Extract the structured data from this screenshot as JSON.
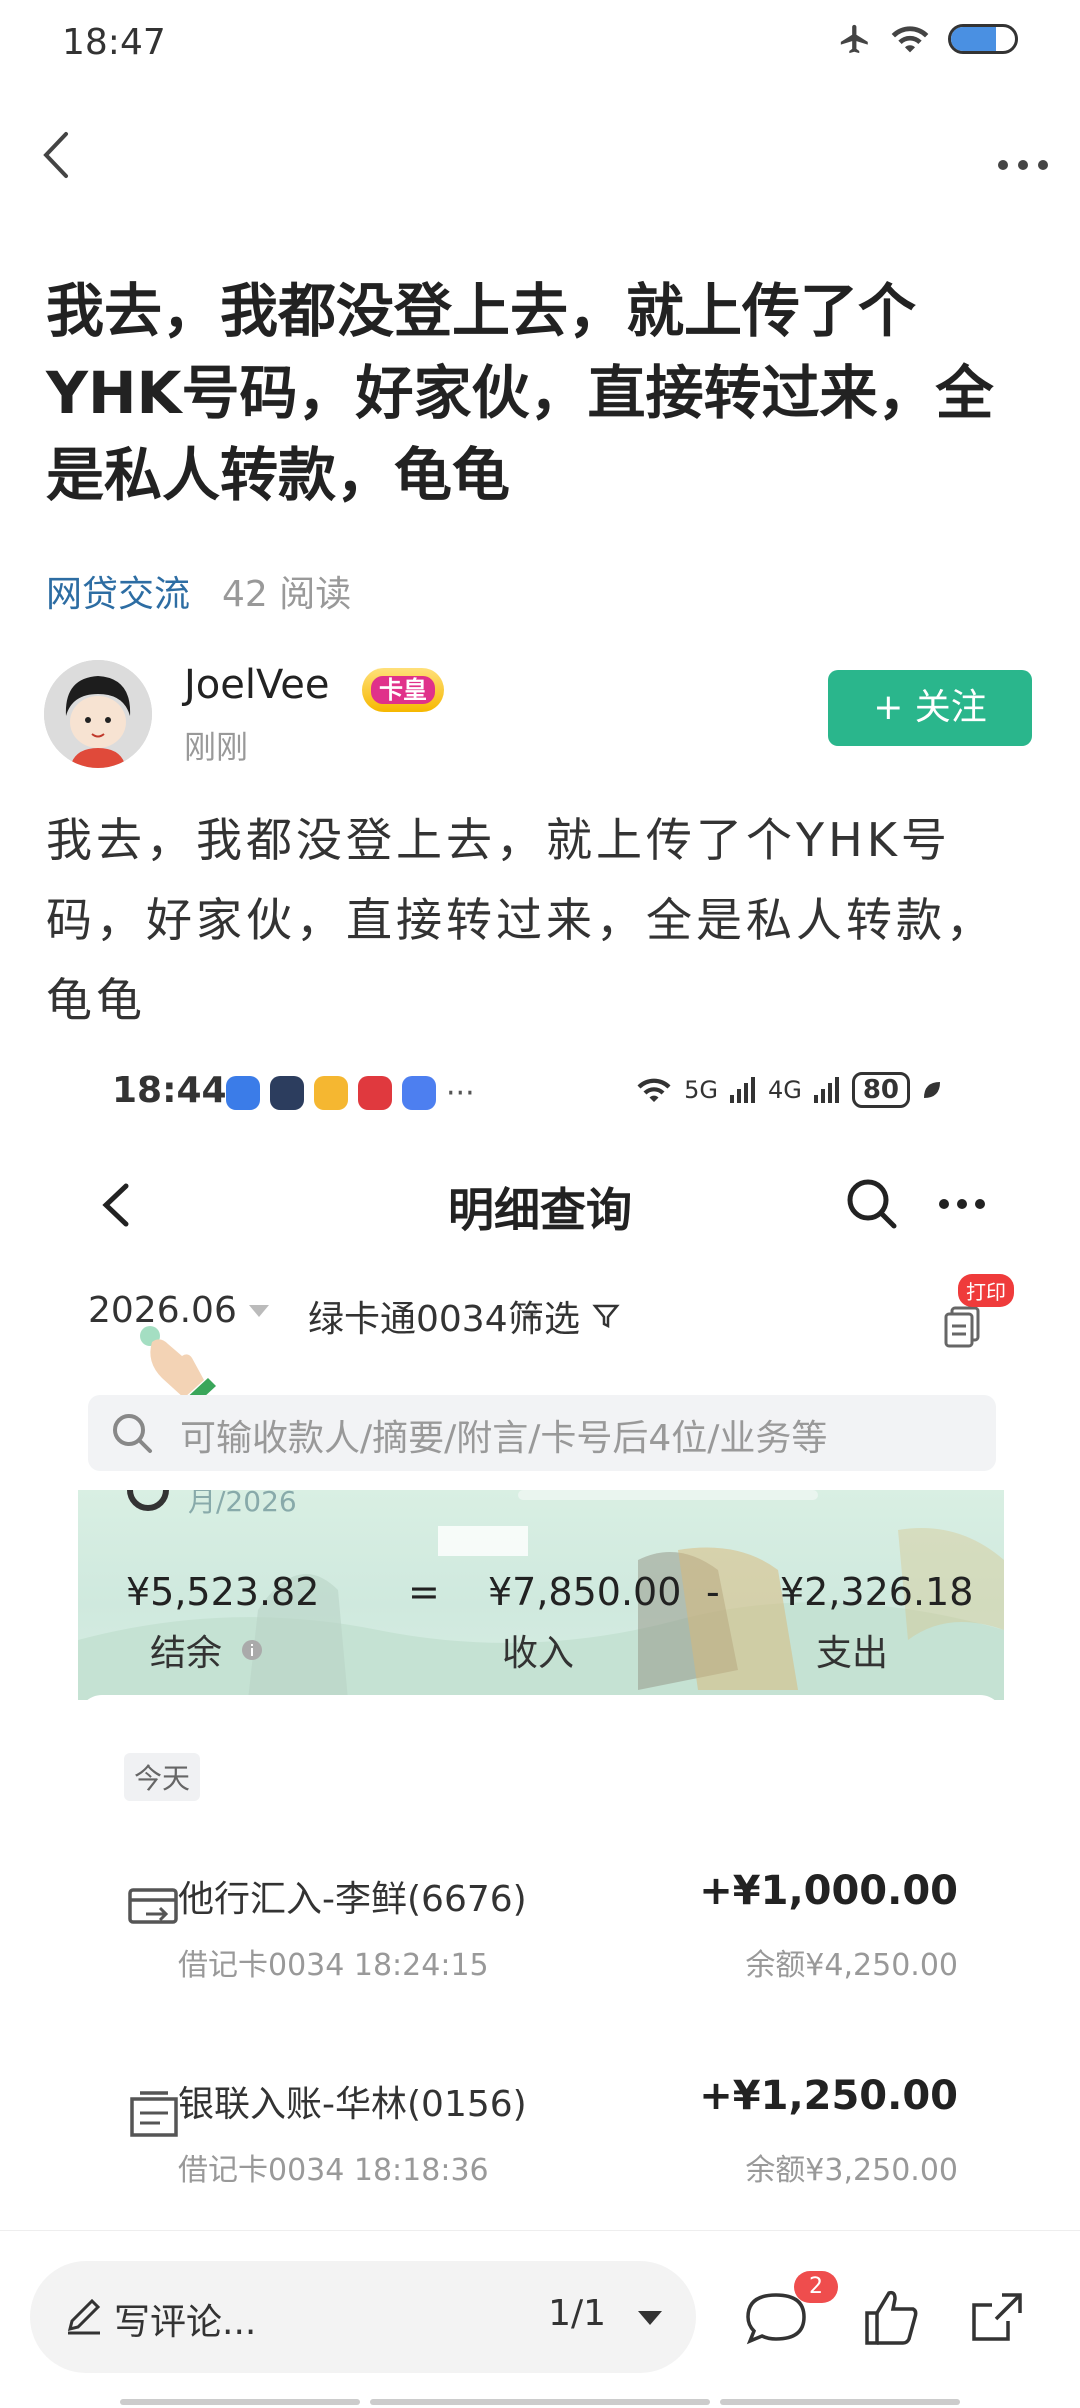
{
  "status_bar": {
    "time": "18:47"
  },
  "nav": {
    "back_icon": "chevron-left-icon",
    "more_icon": "more-horizontal-icon"
  },
  "article": {
    "title": "我去，我都没登上去，就上传了个YHK号码，好家伙，直接转过来，全是私人转款，龟龟",
    "category": "网贷交流",
    "reads": "42 阅读",
    "author": {
      "name": "JoelVee",
      "badge": "卡皇",
      "time": "刚刚",
      "follow_label": "+ 关注"
    },
    "body": "我去，我都没登上去，就上传了个YHK号码，好家伙，直接转过来，全是私人转款，龟龟"
  },
  "embedded": {
    "status_time": "18:44",
    "status_more": "···",
    "status_net": "5G",
    "status_net2": "4G",
    "battery": "80",
    "title": "明细查询",
    "filters": {
      "month": "2026.06",
      "card": "绿卡通0034",
      "filter_label": "筛选",
      "print_tag": "打印"
    },
    "search_placeholder": "可输收款人/摘要/附言/卡号后4位/业务等",
    "summary": {
      "cut_text": "月/2026",
      "balance": "¥5,523.82",
      "eq": "=",
      "income": "¥7,850.00",
      "minus": "-",
      "expense": "¥2,326.18",
      "balance_label": "结余",
      "income_label": "收入",
      "expense_label": "支出"
    },
    "today_label": "今天",
    "transactions": [
      {
        "name": "他行汇入-李鲜(6676)",
        "sub": "借记卡0034 18:24:15",
        "amount": "+¥1,000.00",
        "balance": "余额¥4,250.00"
      },
      {
        "name": "银联入账-华林(0156)",
        "sub": "借记卡0034 18:18:36",
        "amount": "+¥1,250.00",
        "balance": "余额¥3,250.00"
      }
    ]
  },
  "bottom": {
    "comment_placeholder": "写评论...",
    "page": "1/1",
    "comment_count": "2"
  },
  "colors": {
    "accent_green": "#2ab68c",
    "link_blue": "#2d6da3",
    "badge_red": "#ef4d4d"
  }
}
